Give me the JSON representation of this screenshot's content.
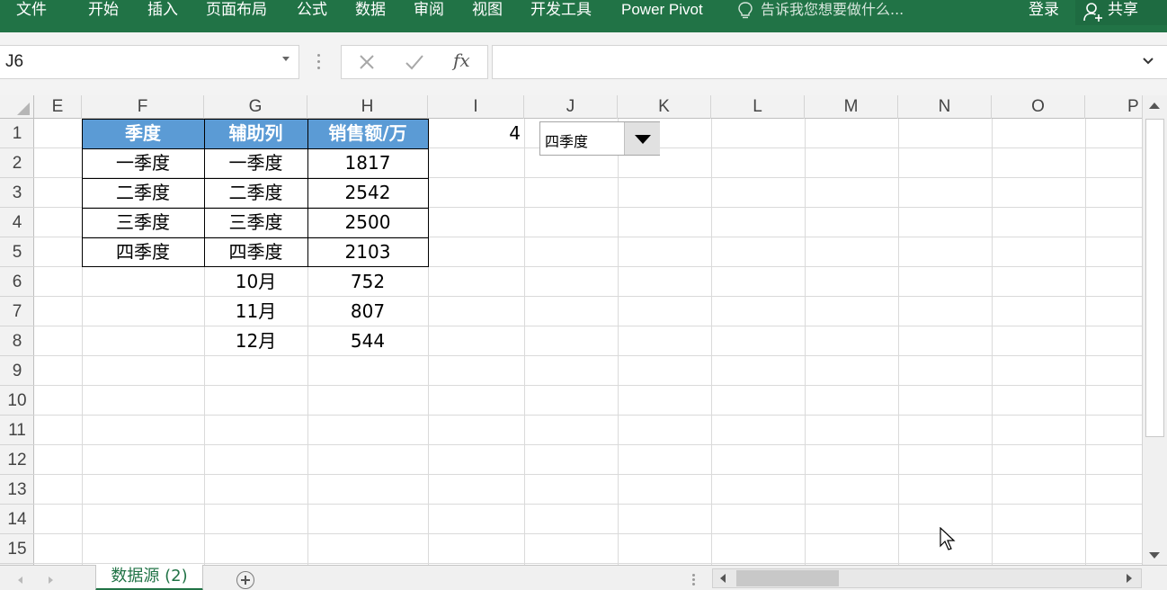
{
  "ribbon": {
    "tabs": [
      "文件",
      "开始",
      "插入",
      "页面布局",
      "公式",
      "数据",
      "审阅",
      "视图",
      "开发工具",
      "Power Pivot"
    ],
    "tell_me": "告诉我您想要做什么...",
    "login": "登录",
    "share": "共享"
  },
  "formula_bar": {
    "name_box": "J6",
    "formula": ""
  },
  "columns": [
    "E",
    "F",
    "G",
    "H",
    "I",
    "J",
    "K",
    "L",
    "M",
    "N",
    "O",
    "P"
  ],
  "rows": [
    "1",
    "2",
    "3",
    "4",
    "5",
    "6",
    "7",
    "8",
    "9",
    "10",
    "11",
    "12",
    "13",
    "14",
    "15"
  ],
  "table": {
    "headers": [
      "季度",
      "辅助列",
      "销售额/万"
    ],
    "rows": [
      [
        "一季度",
        "一季度",
        "1817"
      ],
      [
        "二季度",
        "二季度",
        "2542"
      ],
      [
        "三季度",
        "三季度",
        "2500"
      ],
      [
        "四季度",
        "四季度",
        "2103"
      ],
      [
        "",
        "10月",
        "752"
      ],
      [
        "",
        "11月",
        "807"
      ],
      [
        "",
        "12月",
        "544"
      ]
    ]
  },
  "cell_i1": "4",
  "combo": {
    "value": "四季度"
  },
  "sheet_tab": "数据源 (2)",
  "colors": {
    "ribbon": "#217346",
    "header_fill": "#5b9bd5",
    "header_text": "#ffffff"
  }
}
